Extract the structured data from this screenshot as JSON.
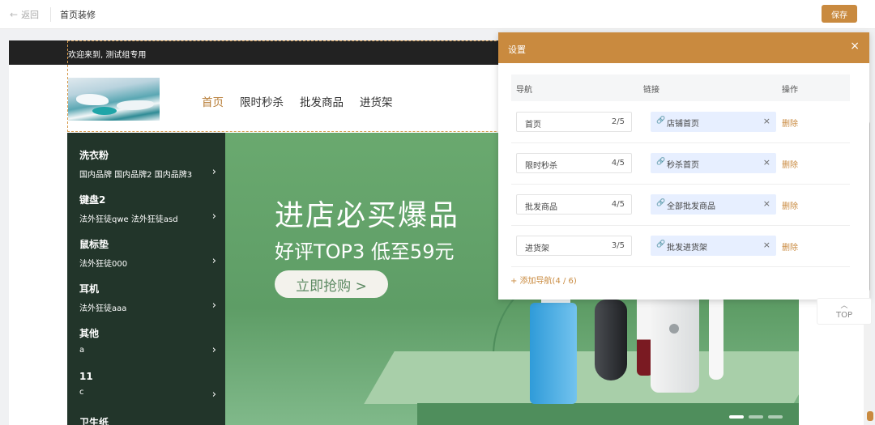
{
  "topbar": {
    "back_label": "返回",
    "title": "首页装修",
    "save_label": "保存"
  },
  "store": {
    "welcome": "欢迎来到, 测试组专用",
    "nav": [
      "首页",
      "限时秒杀",
      "批发商品",
      "进货架"
    ]
  },
  "categories": [
    {
      "title": "洗衣粉",
      "sub": "国内品牌  国内品牌2  国内品牌3"
    },
    {
      "title": "键盘2",
      "sub": "法外狂徒qwe  法外狂徒asd"
    },
    {
      "title": "鼠标垫",
      "sub": "法外狂徒000"
    },
    {
      "title": "耳机",
      "sub": "法外狂徒aaa"
    },
    {
      "title": "其他",
      "sub": "a"
    },
    {
      "title": "11",
      "sub": "c"
    },
    {
      "title": "卫生纸",
      "sub": ""
    }
  ],
  "banner": {
    "title": "进店必买爆品",
    "subtitle": "好评TOP3 低至59元",
    "button": "立即抢购 >"
  },
  "settings": {
    "title": "设置",
    "columns": {
      "nav": "导航",
      "link": "链接",
      "action": "操作"
    },
    "rows": [
      {
        "name": "首页",
        "count": "2/5",
        "link": "店铺首页",
        "action": "删除"
      },
      {
        "name": "限时秒杀",
        "count": "4/5",
        "link": "秒杀首页",
        "action": "删除"
      },
      {
        "name": "批发商品",
        "count": "4/5",
        "link": "全部批发商品",
        "action": "删除"
      },
      {
        "name": "进货架",
        "count": "3/5",
        "link": "批发进货架",
        "action": "删除"
      }
    ],
    "add_label": "+ 添加导航(4 / 6)"
  },
  "top_button": "TOP",
  "colors": {
    "accent": "#c98a3f",
    "sidebar": "#22352a",
    "banner": "#6aa96f"
  }
}
